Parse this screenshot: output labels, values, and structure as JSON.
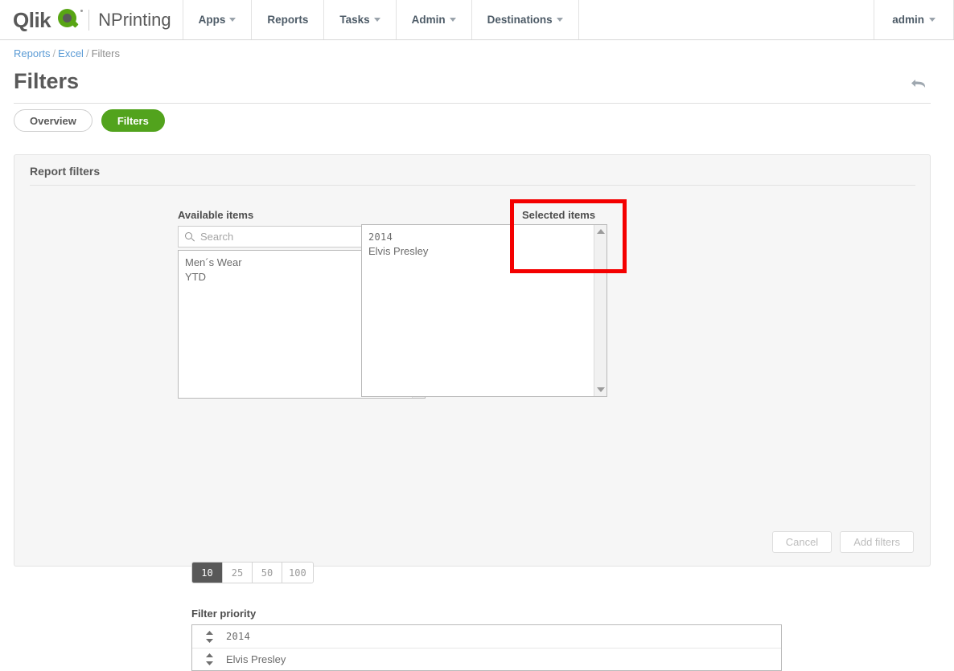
{
  "navbar": {
    "logo_word": "Qlik",
    "logo_mark": "qlik-q-logo",
    "product": "NPrinting",
    "items": [
      {
        "label": "Apps",
        "has_caret": true
      },
      {
        "label": "Reports",
        "has_caret": false
      },
      {
        "label": "Tasks",
        "has_caret": true
      },
      {
        "label": "Admin",
        "has_caret": true
      },
      {
        "label": "Destinations",
        "has_caret": true
      }
    ],
    "user": "admin"
  },
  "breadcrumb": {
    "root": "Reports",
    "middle": "Excel",
    "current": "Filters",
    "separator": "/"
  },
  "page": {
    "title": "Filters",
    "back_icon": "back-arrow-icon"
  },
  "tabs": [
    {
      "label": "Overview",
      "active": false
    },
    {
      "label": "Filters",
      "active": true
    }
  ],
  "card": {
    "title": "Report filters",
    "available": {
      "label": "Available items",
      "search_placeholder": "Search",
      "search_value": "",
      "items": [
        "Men´s Wear",
        "YTD"
      ]
    },
    "selected": {
      "label": "Selected items",
      "items": [
        "2014",
        "Elvis Presley"
      ]
    },
    "transfer_buttons": [
      {
        "glyph": "›",
        "name": "move-right-button"
      },
      {
        "glyph": "‹",
        "name": "move-left-button"
      },
      {
        "glyph": "»",
        "name": "move-all-right-button"
      },
      {
        "glyph": "«",
        "name": "move-all-left-button"
      }
    ],
    "page_sizes": [
      {
        "label": "10",
        "active": true
      },
      {
        "label": "25",
        "active": false
      },
      {
        "label": "50",
        "active": false
      },
      {
        "label": "100",
        "active": false
      }
    ],
    "filter_priority": {
      "label": "Filter priority",
      "rows": [
        "2014",
        "Elvis Presley"
      ],
      "handle_glyph": "⬍"
    },
    "footer": {
      "cancel_label": "Cancel",
      "submit_label": "Add filters"
    }
  },
  "annotation": {
    "color": "#f40000",
    "target": "selected-items"
  },
  "colors": {
    "accent_green": "#52a31d",
    "link_blue": "#5b9bd5",
    "text": "#595959"
  }
}
